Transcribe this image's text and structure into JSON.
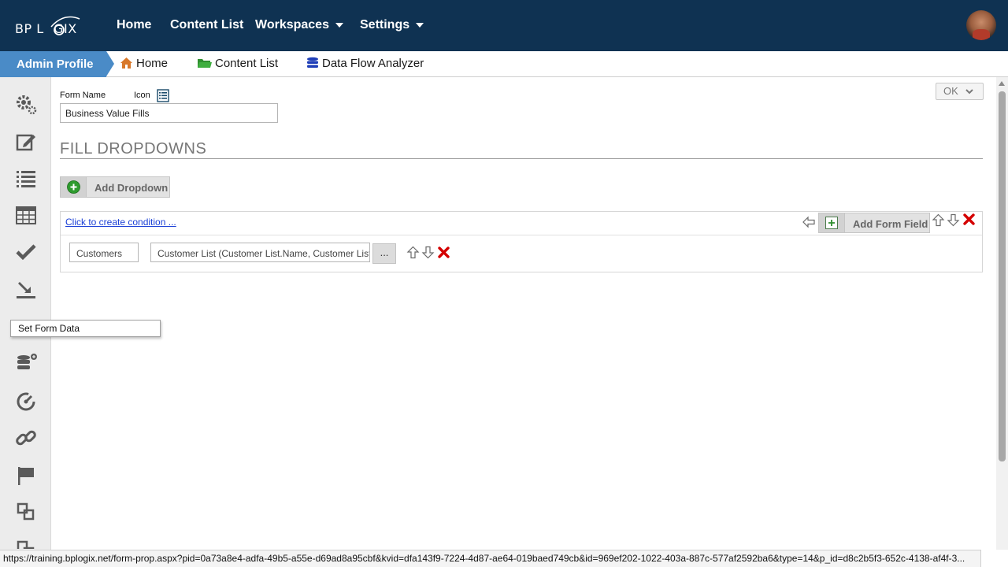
{
  "topnav": {
    "logo_text": "BPLOGIX",
    "items": [
      {
        "label": "Home"
      },
      {
        "label": "Content List"
      },
      {
        "label": "Workspaces"
      },
      {
        "label": "Settings"
      }
    ]
  },
  "subnav": {
    "profile": "Admin Profile",
    "crumbs": [
      {
        "label": "Home",
        "icon": "home-icon"
      },
      {
        "label": "Content List",
        "icon": "folder-icon"
      },
      {
        "label": "Data Flow Analyzer",
        "icon": "database-icon"
      }
    ]
  },
  "sidebar": {
    "icons": [
      "gears-icon",
      "edit-icon",
      "list-icon",
      "table-icon",
      "check-icon",
      "set-form-data-icon",
      "database-add-icon",
      "gauge-icon",
      "link-icon",
      "flag-icon",
      "stack-icon"
    ]
  },
  "tooltip": {
    "text": "Set Form Data"
  },
  "form": {
    "form_name_label": "Form Name",
    "icon_label": "Icon",
    "form_name_value": "Business Value Fills",
    "ok_label": "OK",
    "section_title": "FILL DROPDOWNS",
    "add_dropdown_label": "Add Dropdown",
    "condition_link": "Click to create condition ...",
    "add_form_field_label": "Add Form Field",
    "row": {
      "field": "Customers",
      "source": "Customer List (Customer List.Name, Customer List.Name)",
      "ellipsis": "..."
    }
  },
  "statusbar": {
    "url": "https://training.bplogix.net/form-prop.aspx?pid=0a73a8e4-adfa-49b5-a55e-d69ad8a95cbf&kvid=dfa143f9-7224-4d87-ae64-019baed749cb&id=969ef202-1022-403a-887c-577af2592ba6&type=14&p_id=d8c2b5f3-652c-4138-af4f-3..."
  },
  "colors": {
    "topnav_bg": "#0f3252",
    "profile_tab": "#4a8bc7",
    "link": "#1a3fd6",
    "delete_red": "#d40000",
    "add_green": "#2e9b2e"
  }
}
